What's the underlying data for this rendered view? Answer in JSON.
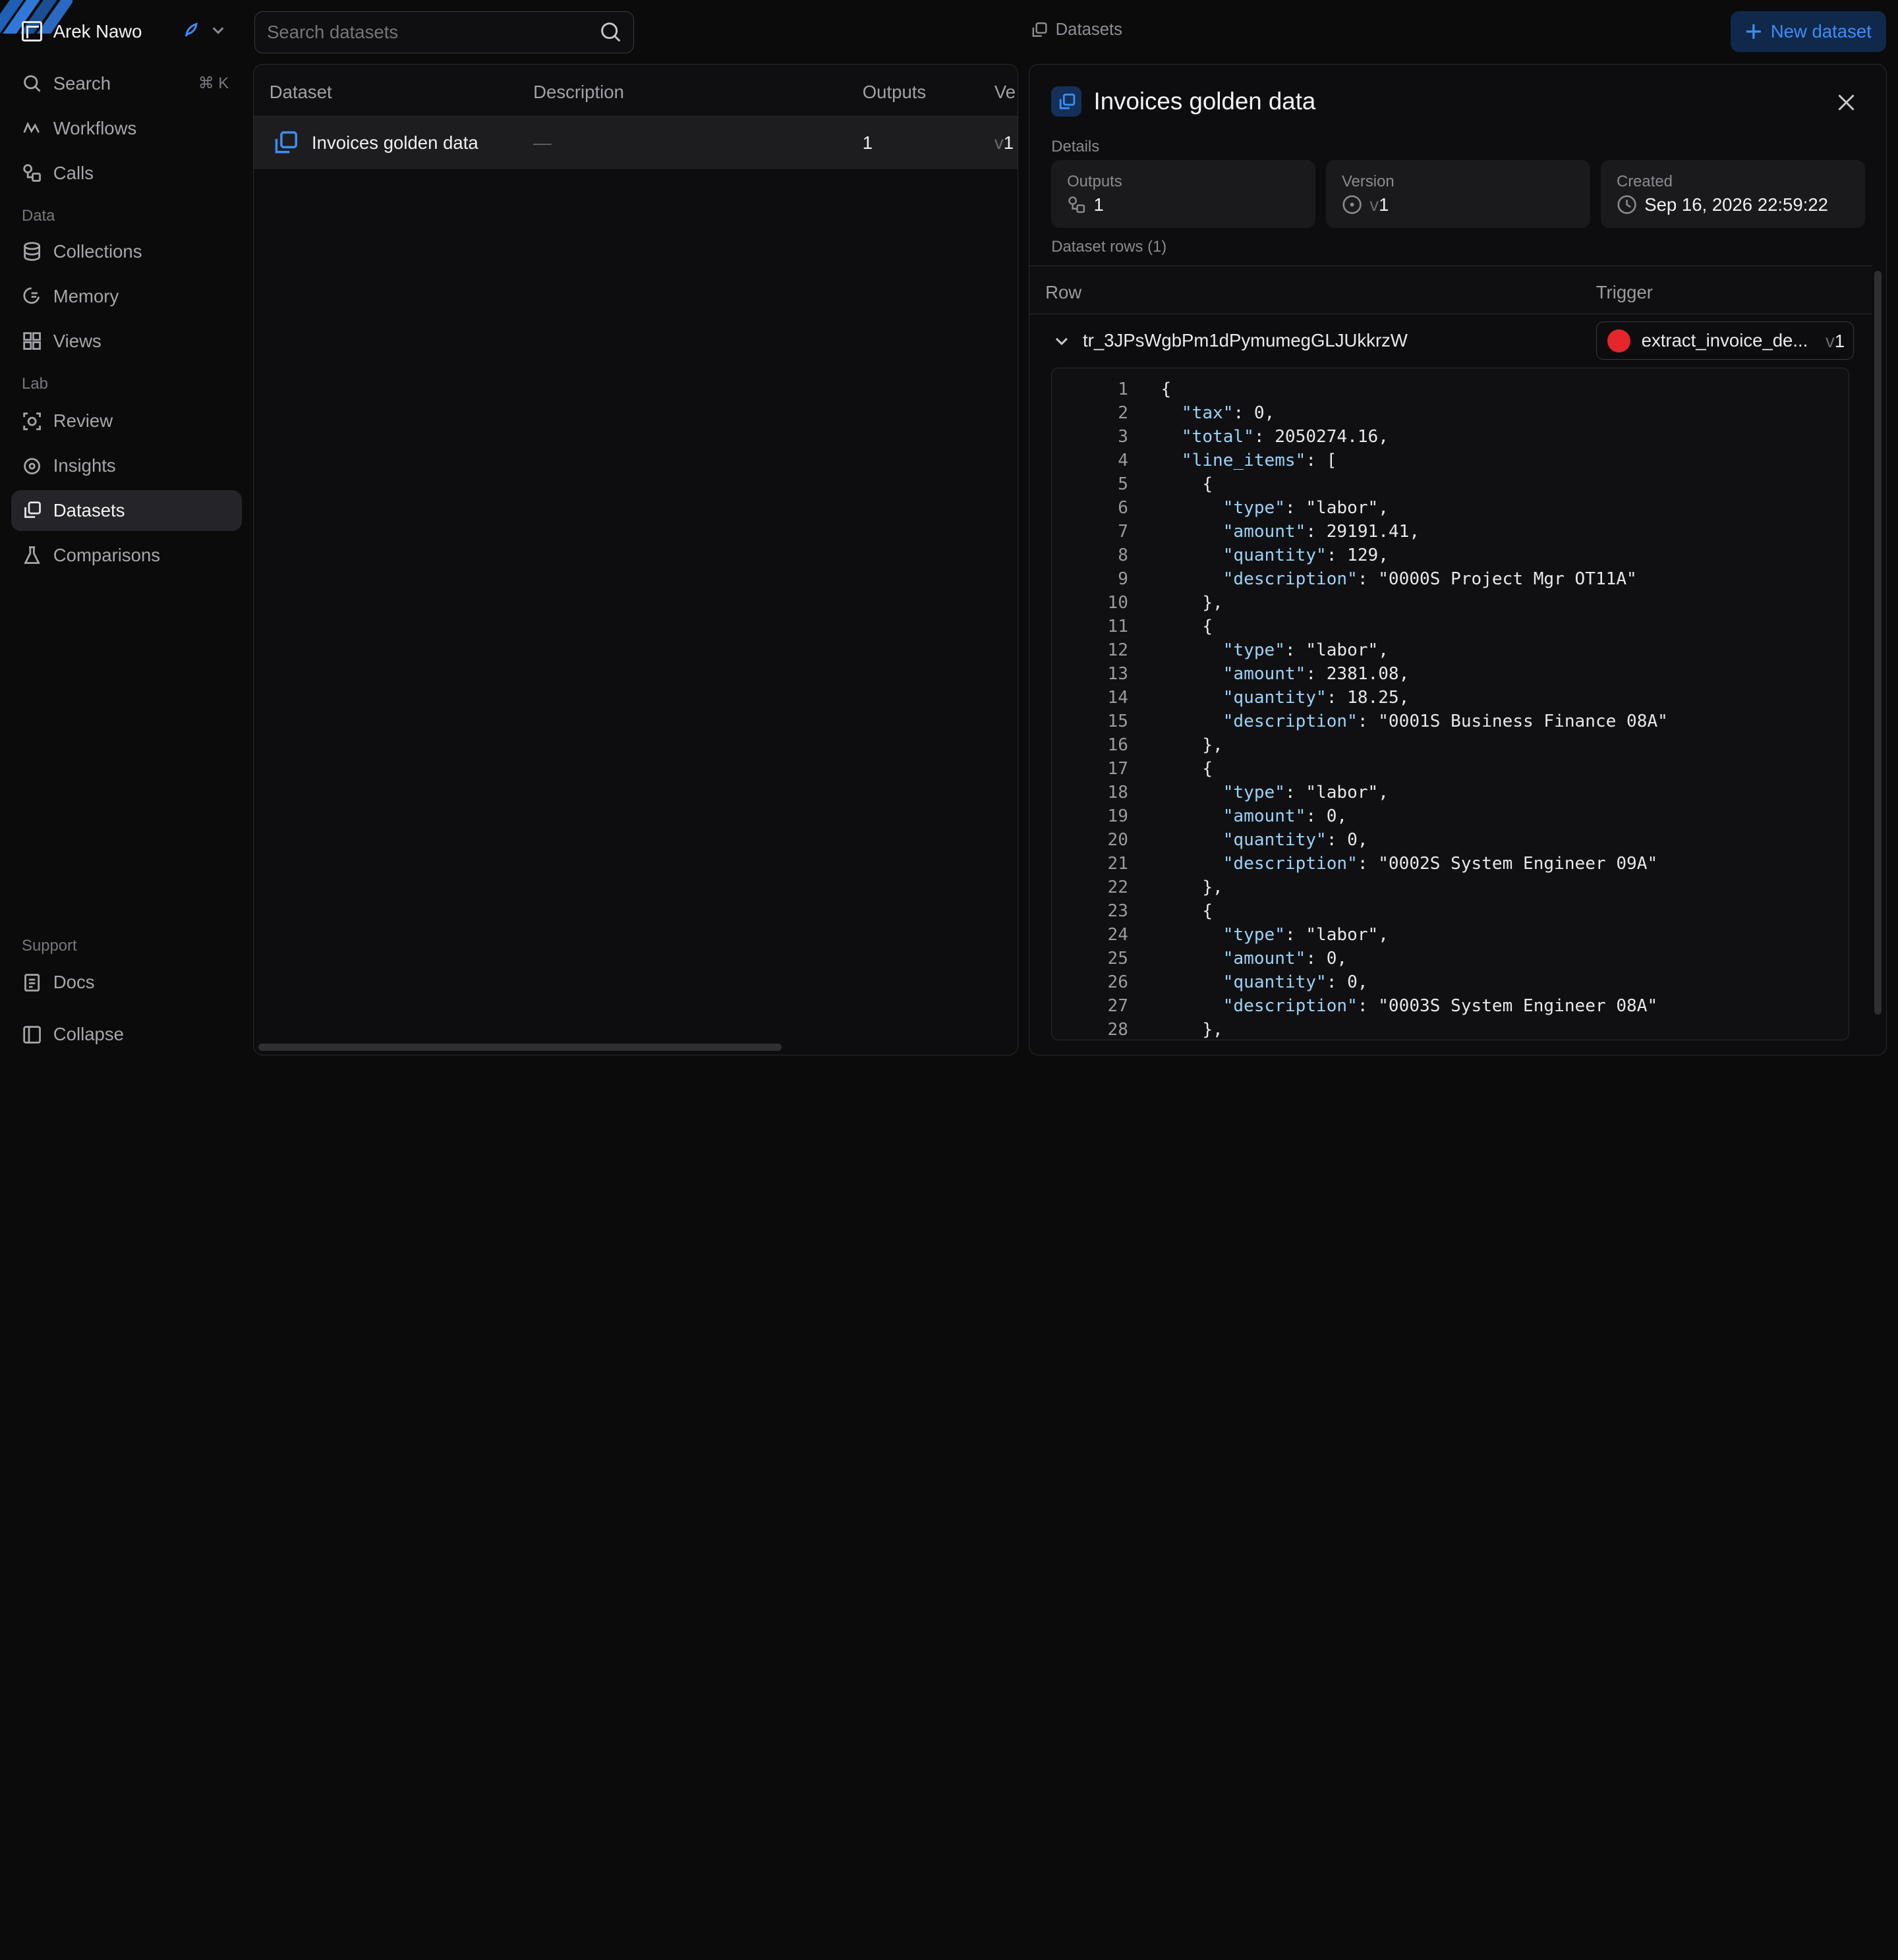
{
  "sidebar": {
    "workspace": "Arek Nawo",
    "nav": [
      {
        "label": "Search",
        "shortcut": "⌘ K"
      },
      {
        "label": "Workflows"
      },
      {
        "label": "Calls"
      }
    ],
    "data_section": "Data",
    "data_items": [
      {
        "label": "Collections"
      },
      {
        "label": "Memory"
      },
      {
        "label": "Views"
      }
    ],
    "lab_section": "Lab",
    "lab_items": [
      {
        "label": "Review"
      },
      {
        "label": "Insights"
      },
      {
        "label": "Datasets"
      },
      {
        "label": "Comparisons"
      }
    ],
    "support_section": "Support",
    "docs": "Docs",
    "collapse": "Collapse"
  },
  "topbar": {
    "search_placeholder": "Search datasets",
    "breadcrumb": "Datasets",
    "new_button": "New dataset"
  },
  "table": {
    "columns": [
      "Dataset",
      "Description",
      "Outputs",
      "Ve"
    ],
    "rows": [
      {
        "name": "Invoices golden data",
        "description": "—",
        "outputs": "1",
        "version_prefix": "v",
        "version": "1"
      }
    ]
  },
  "detail": {
    "title": "Invoices golden data",
    "details_label": "Details",
    "cards": {
      "outputs_label": "Outputs",
      "outputs_value": "1",
      "version_label": "Version",
      "version_prefix": "v",
      "version_value": "1",
      "created_label": "Created",
      "created_value": "Sep 16, 2026 22:59:22"
    },
    "rows_label": "Dataset rows (1)",
    "rows_columns": {
      "row": "Row",
      "trigger": "Trigger"
    },
    "row": {
      "id": "tr_3JPsWgbPm1dPymumegGLJUkkrzW",
      "trigger_name": "extract_invoice_de...",
      "trigger_version_prefix": "v",
      "trigger_version": "1"
    },
    "code_lines": [
      {
        "n": "1",
        "t": "{"
      },
      {
        "n": "2",
        "t": "  \"tax\": 0,"
      },
      {
        "n": "3",
        "t": "  \"total\": 2050274.16,"
      },
      {
        "n": "4",
        "t": "  \"line_items\": ["
      },
      {
        "n": "5",
        "t": "    {"
      },
      {
        "n": "6",
        "t": "      \"type\": \"labor\","
      },
      {
        "n": "7",
        "t": "      \"amount\": 29191.41,"
      },
      {
        "n": "8",
        "t": "      \"quantity\": 129,"
      },
      {
        "n": "9",
        "t": "      \"description\": \"0000S Project Mgr OT11A\""
      },
      {
        "n": "10",
        "t": "    },"
      },
      {
        "n": "11",
        "t": "    {"
      },
      {
        "n": "12",
        "t": "      \"type\": \"labor\","
      },
      {
        "n": "13",
        "t": "      \"amount\": 2381.08,"
      },
      {
        "n": "14",
        "t": "      \"quantity\": 18.25,"
      },
      {
        "n": "15",
        "t": "      \"description\": \"0001S Business Finance 08A\""
      },
      {
        "n": "16",
        "t": "    },"
      },
      {
        "n": "17",
        "t": "    {"
      },
      {
        "n": "18",
        "t": "      \"type\": \"labor\","
      },
      {
        "n": "19",
        "t": "      \"amount\": 0,"
      },
      {
        "n": "20",
        "t": "      \"quantity\": 0,"
      },
      {
        "n": "21",
        "t": "      \"description\": \"0002S System Engineer 09A\""
      },
      {
        "n": "22",
        "t": "    },"
      },
      {
        "n": "23",
        "t": "    {"
      },
      {
        "n": "24",
        "t": "      \"type\": \"labor\","
      },
      {
        "n": "25",
        "t": "      \"amount\": 0,"
      },
      {
        "n": "26",
        "t": "      \"quantity\": 0,"
      },
      {
        "n": "27",
        "t": "      \"description\": \"0003S System Engineer 08A\""
      },
      {
        "n": "28",
        "t": "    },"
      }
    ]
  },
  "colors": {
    "accent": "#3d8ef5",
    "accent_bg": "#10284a",
    "active_nav": "#252529",
    "trigger_dot": "#e5262a",
    "json_key": "#9ad3f5",
    "json_string": "#e7a77f"
  },
  "icons": [
    "search-icon",
    "workflows-icon",
    "calls-icon",
    "database-icon",
    "memory-icon",
    "views-icon",
    "review-icon",
    "insights-icon",
    "datasets-icon",
    "flask-icon",
    "docs-icon",
    "collapse-icon",
    "rocket-icon",
    "chevron-down-icon",
    "plus-icon",
    "close-icon",
    "outputs-icon",
    "version-icon",
    "clock-icon"
  ]
}
